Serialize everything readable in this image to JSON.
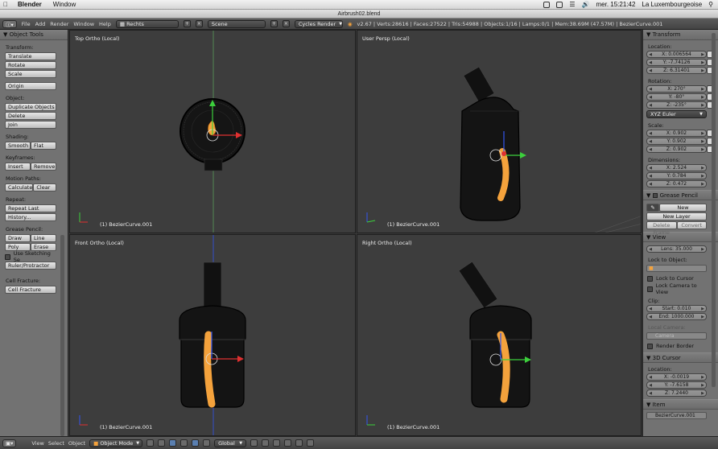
{
  "macbar": {
    "app_name": "Blender",
    "menus": [
      "Window"
    ],
    "datetime": "mer. 15:21:42",
    "location": "La Luxembourgeoise"
  },
  "window": {
    "title": "Airbrush02.blend"
  },
  "infobar": {
    "menus": [
      "File",
      "Add",
      "Render",
      "Window",
      "Help"
    ],
    "layout": "Rechts",
    "scene": "Scene",
    "engine": "Cycles Render",
    "stats": "v2.67 | Verts:28616 | Faces:27522 | Tris:54988 | Objects:1/16 | Lamps:0/1 | Mem:38.69M (47.57M) | BezierCurve.001"
  },
  "toolshelf": {
    "title": "Object Tools",
    "transform_label": "Transform:",
    "translate": "Translate",
    "rotate": "Rotate",
    "scale": "Scale",
    "origin": "Origin",
    "object_label": "Object:",
    "duplicate": "Duplicate Objects",
    "delete": "Delete",
    "join": "Join",
    "shading_label": "Shading:",
    "smooth": "Smooth",
    "flat": "Flat",
    "keyframes_label": "Keyframes:",
    "insert": "Insert",
    "remove": "Remove",
    "motion_label": "Motion Paths:",
    "calculate": "Calculate",
    "clear": "Clear",
    "repeat_label": "Repeat:",
    "repeat_last": "Repeat Last",
    "history": "History...",
    "grease_label": "Grease Pencil:",
    "draw": "Draw",
    "line": "Line",
    "poly": "Poly",
    "erase": "Erase",
    "use_sketching": "Use Sketching Se",
    "ruler": "Ruler/Protractor",
    "cell_label": "Cell Fracture:",
    "cell_fracture": "Cell Fracture"
  },
  "viewports": [
    {
      "title": "Top Ortho (Local)",
      "object": "(1) BezierCurve.001"
    },
    {
      "title": "User Persp (Local)",
      "object": "(1) BezierCurve.001"
    },
    {
      "title": "Front Ortho (Local)",
      "object": "(1) BezierCurve.001"
    },
    {
      "title": "Right Ortho (Local)",
      "object": "(1) BezierCurve.001"
    }
  ],
  "props": {
    "transform_title": "Transform",
    "location_label": "Location:",
    "loc_x": "X: 0.006564",
    "loc_y": "Y: -7.74126",
    "loc_z": "Z: 6.31401",
    "rotation_label": "Rotation:",
    "rot_x": "X: 270°",
    "rot_y": "Y: -80°",
    "rot_z": "Z: -235°",
    "rotation_mode": "XYZ Euler",
    "scale_label": "Scale:",
    "sc_x": "X: 0.902",
    "sc_y": "Y: 0.902",
    "sc_z": "Z: 0.902",
    "dimensions_label": "Dimensions:",
    "dim_x": "X: 2.524",
    "dim_y": "Y: 0.784",
    "dim_z": "Z: 0.472",
    "grease_title": "Grease Pencil",
    "new": "New",
    "new_layer": "New Layer",
    "delete_frame": "Delete Frame",
    "convert": "Convert",
    "view_title": "View",
    "lens": "Lens: 35.000",
    "lock_to_object": "Lock to Object:",
    "lock_to_cursor": "Lock to Cursor",
    "lock_camera": "Lock Camera to View",
    "clip_label": "Clip:",
    "clip_start": "Start: 0.010",
    "clip_end": "End: 1000.000",
    "local_camera": "Local Camera:",
    "camera": "Camera",
    "render_border": "Render Border",
    "cursor_title": "3D Cursor",
    "cursor_location": "Location:",
    "cur_x": "X: -0.0019",
    "cur_y": "Y: -7.6158",
    "cur_z": "Z: 7.2440",
    "item_title": "Item",
    "item_name": "BezierCurve.001"
  },
  "bottombar": {
    "view": "View",
    "select": "Select",
    "object": "Object",
    "mode": "Object Mode",
    "orientation": "Global"
  },
  "colors": {
    "viewport_bg": "#3d3d3d",
    "panel_bg": "#727272",
    "selection_orange": "#f4a23c",
    "axis_red": "#e03030",
    "axis_green": "#3ccf3c",
    "axis_blue": "#3355ee"
  }
}
